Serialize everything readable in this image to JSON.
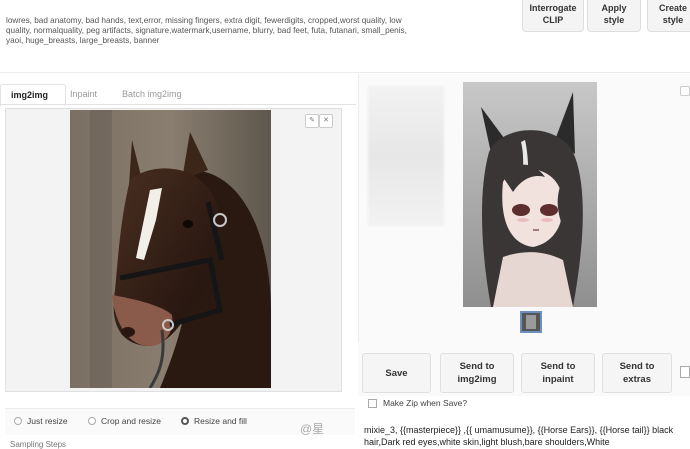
{
  "negative_prompt": "lowres, bad anatomy, bad hands, text,error, missing fingers, extra digit, fewerdigits, cropped,worst quality, low quality, normalquality, peg artifacts, signature,watermark,username, blurry, bad feet, futa, futanari, small_penis, yaoi, huge_breasts, large_breasts, banner",
  "top_buttons": {
    "interrogate_line1": "Interrogate",
    "interrogate_line2": "CLIP",
    "apply_line1": "Apply",
    "apply_line2": "style",
    "create_line1": "Create",
    "create_line2": "style"
  },
  "tabs": [
    "img2img",
    "Inpaint",
    "Batch img2img"
  ],
  "resize_modes": [
    {
      "label": "Just resize",
      "checked": false
    },
    {
      "label": "Crop and resize",
      "checked": false
    },
    {
      "label": "Resize and fill",
      "checked": true
    }
  ],
  "sampling_steps_label": "Sampling Steps",
  "action_buttons": {
    "save": "Save",
    "send_img2img_line1": "Send to",
    "send_img2img_line2": "img2img",
    "send_inpaint_line1": "Send to",
    "send_inpaint_line2": "inpaint",
    "send_extras_line1": "Send to",
    "send_extras_line2": "extras"
  },
  "make_zip_label": "Make Zip when Save?",
  "positive_prompt": "mixie_3, {{masterpiece}} ,{{ umamusume}}, {{Horse Ears}}, {{Horse tail}} black hair,Dark red eyes,white skin,light blush,bare shoulders,White",
  "watermark": "@星"
}
